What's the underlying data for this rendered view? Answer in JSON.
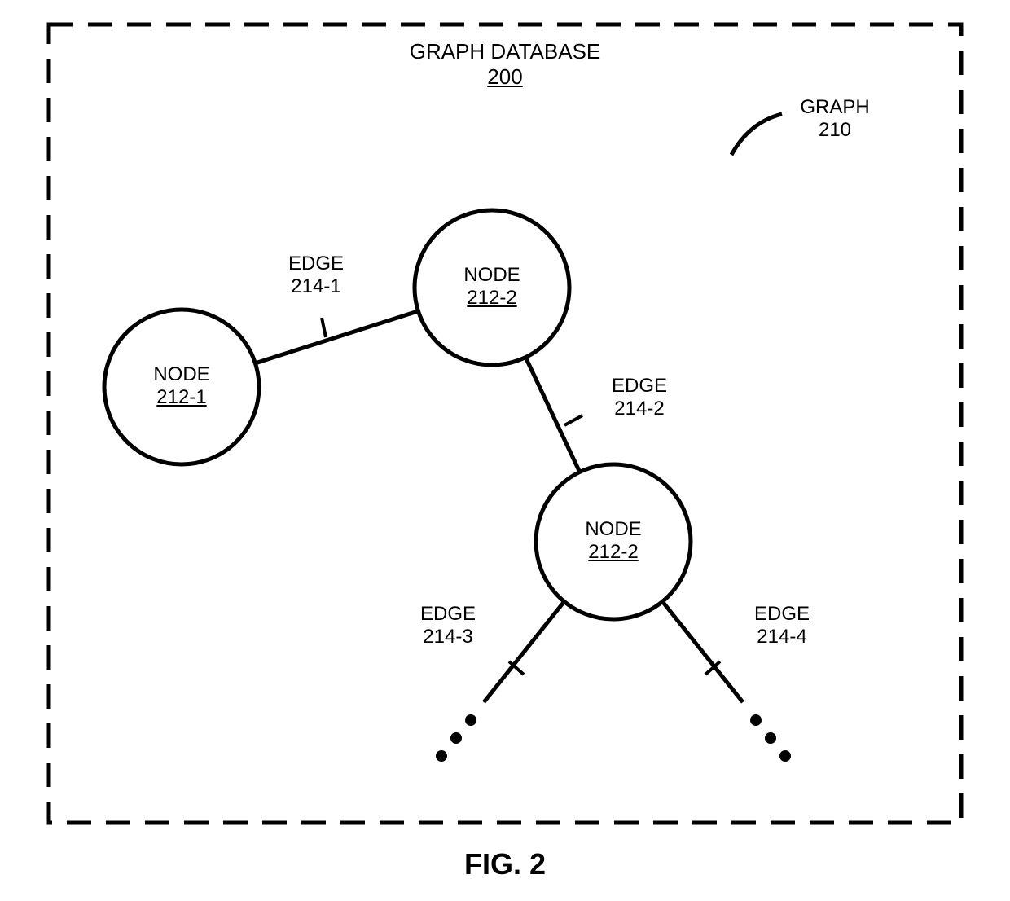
{
  "title": {
    "line1": "GRAPH DATABASE",
    "line2": "200"
  },
  "graph_indicator": {
    "label": "GRAPH",
    "id": "210"
  },
  "nodes": [
    {
      "label": "NODE",
      "id": "212-1"
    },
    {
      "label": "NODE",
      "id": "212-2"
    },
    {
      "label": "NODE",
      "id": "212-2"
    }
  ],
  "edges": [
    {
      "label": "EDGE",
      "id": "214-1"
    },
    {
      "label": "EDGE",
      "id": "214-2"
    },
    {
      "label": "EDGE",
      "id": "214-3"
    },
    {
      "label": "EDGE",
      "id": "214-4"
    }
  ],
  "figure_label": "FIG. 2"
}
